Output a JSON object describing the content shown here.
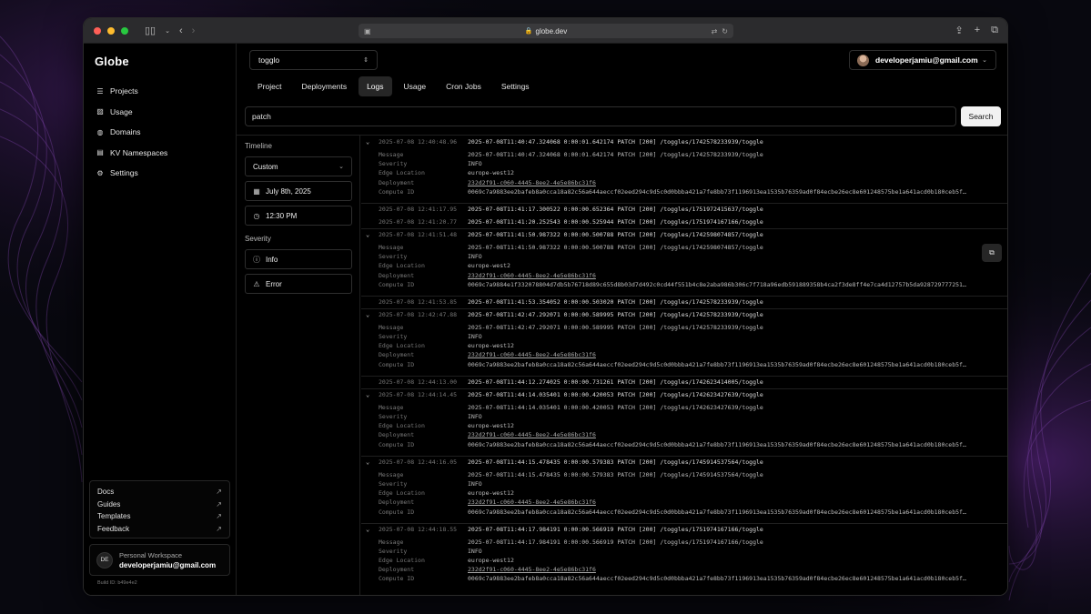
{
  "browser": {
    "url": "globe.dev"
  },
  "app": {
    "logo": "Globe",
    "build_id": "Build ID: b49e4e2"
  },
  "sidebar": {
    "items": [
      {
        "label": "Projects",
        "icon": "database-icon"
      },
      {
        "label": "Usage",
        "icon": "chart-icon"
      },
      {
        "label": "Domains",
        "icon": "globe-icon"
      },
      {
        "label": "KV Namespaces",
        "icon": "table-icon"
      },
      {
        "label": "Settings",
        "icon": "gear-icon"
      }
    ],
    "links": [
      {
        "label": "Docs"
      },
      {
        "label": "Guides"
      },
      {
        "label": "Templates"
      },
      {
        "label": "Feedback"
      }
    ],
    "workspace": {
      "initials": "DE",
      "label": "Personal Workspace",
      "email": "developerjamiu@gmail.com"
    }
  },
  "header": {
    "project": "togglo",
    "user_email": "developerjamiu@gmail.com",
    "tabs": [
      {
        "label": "Project"
      },
      {
        "label": "Deployments"
      },
      {
        "label": "Logs"
      },
      {
        "label": "Usage"
      },
      {
        "label": "Cron Jobs"
      },
      {
        "label": "Settings"
      }
    ],
    "active_tab": "Logs"
  },
  "search": {
    "value": "patch",
    "button": "Search"
  },
  "filters": {
    "timeline_label": "Timeline",
    "range": "Custom",
    "date": "July 8th, 2025",
    "time": "12:30 PM",
    "severity_label": "Severity",
    "severity_options": [
      "Info",
      "Error"
    ]
  },
  "detail_labels": {
    "message": "Message",
    "severity": "Severity",
    "edge": "Edge Location",
    "deployment": "Deployment",
    "compute": "Compute ID"
  },
  "logs": [
    {
      "ts": "2025-07-08 12:40:48.96",
      "msg": "2025-07-08T11:40:47.324068 0:00:01.642174 PATCH [200] /toggles/1742578233939/toggle",
      "expanded": true,
      "detail_msg": "2025-07-08T11:40:47.324068  0:00:01.642174  PATCH   [200] /toggles/1742578233939/toggle",
      "severity": "INFO",
      "edge": "europe-west12",
      "deployment": "232d2f91-c060-4445-8ee2-4e5e86bc31f6",
      "compute": "0069c7a9883ee2bafeb8a0cca18a82c56a644aeccf02eed294c9d5c0d0bbba421a7fe8bb73f1196913ea1535b76359ad0f84ecbe26ec8e601248575be1a641acd0b180ceb5f…"
    },
    {
      "ts": "2025-07-08 12:41:17.95",
      "msg": "2025-07-08T11:41:17.300522 0:00:00.652364 PATCH [200] /toggles/1751972415637/toggle",
      "expanded": false
    },
    {
      "ts": "2025-07-08 12:41:20.77",
      "msg": "2025-07-08T11:41:20.252543 0:00:00.525944 PATCH [200] /toggles/1751974167166/toggle",
      "expanded": false
    },
    {
      "ts": "2025-07-08 12:41:51.48",
      "msg": "2025-07-08T11:41:50.987322 0:00:00.500788 PATCH [200] /toggles/1742598074857/toggle",
      "expanded": true,
      "copy": true,
      "detail_msg": "2025-07-08T11:41:50.987322  0:00:00.500788  PATCH   [200] /toggles/1742598074857/toggle",
      "severity": "INFO",
      "edge": "europe-west2",
      "deployment": "232d2f91-c060-4445-8ee2-4e5e86bc31f6",
      "compute": "0069c7a9884e1f332078804d7db5b76718d89c655d8b03d7d492c0cd44f551b4c8e2aba986b306c7f718a96edb591889358b4ca2f3de8ff4e7ca4d12757b5da928729777251…"
    },
    {
      "ts": "2025-07-08 12:41:53.85",
      "msg": "2025-07-08T11:41:53.354052 0:00:00.503020 PATCH [200] /toggles/1742578233939/toggle",
      "expanded": false
    },
    {
      "ts": "2025-07-08 12:42:47.88",
      "msg": "2025-07-08T11:42:47.292071 0:00:00.589995 PATCH [200] /toggles/1742578233939/toggle",
      "expanded": true,
      "detail_msg": "2025-07-08T11:42:47.292071  0:00:00.589995  PATCH   [200] /toggles/1742578233939/toggle",
      "severity": "INFO",
      "edge": "europe-west12",
      "deployment": "232d2f91-c060-4445-8ee2-4e5e86bc31f6",
      "compute": "0069c7a9883ee2bafeb8a0cca18a82c56a644aeccf02eed294c9d5c0d0bbba421a7fe8bb73f1196913ea1535b76359ad0f84ecbe26ec8e601248575be1a641acd0b180ceb5f…"
    },
    {
      "ts": "2025-07-08 12:44:13.00",
      "msg": "2025-07-08T11:44:12.274025 0:00:00.731261 PATCH [200] /toggles/1742623414005/toggle",
      "expanded": false
    },
    {
      "ts": "2025-07-08 12:44:14.45",
      "msg": "2025-07-08T11:44:14.035401 0:00:00.420053 PATCH [200] /toggles/1742623427639/toggle",
      "expanded": true,
      "detail_msg": "2025-07-08T11:44:14.035401  0:00:00.420053  PATCH   [200] /toggles/1742623427639/toggle",
      "severity": "INFO",
      "edge": "europe-west12",
      "deployment": "232d2f91-c060-4445-8ee2-4e5e86bc31f6",
      "compute": "0069c7a9883ee2bafeb8a0cca18a82c56a644aeccf02eed294c9d5c0d0bbba421a7fe8bb73f1196913ea1535b76359ad0f84ecbe26ec8e601248575be1a641acd0b180ceb5f…"
    },
    {
      "ts": "2025-07-08 12:44:16.05",
      "msg": "2025-07-08T11:44:15.478435 0:00:00.579383 PATCH [200] /toggles/1745914537564/toggle",
      "expanded": true,
      "detail_msg": "2025-07-08T11:44:15.478435  0:00:00.579383  PATCH   [200] /toggles/1745914537564/toggle",
      "severity": "INFO",
      "edge": "europe-west12",
      "deployment": "232d2f91-c060-4445-8ee2-4e5e86bc31f6",
      "compute": "0069c7a9883ee2bafeb8a0cca18a82c56a644aeccf02eed294c9d5c0d0bbba421a7fe8bb73f1196913ea1535b76359ad0f84ecbe26ec8e601248575be1a641acd0b180ceb5f…"
    },
    {
      "ts": "2025-07-08 12:44:18.55",
      "msg": "2025-07-08T11:44:17.984191 0:00:00.566919 PATCH [200] /toggles/1751974167166/toggle",
      "expanded": true,
      "detail_msg": "2025-07-08T11:44:17.984191  0:00:00.566919  PATCH   [200] /toggles/1751974167166/toggle",
      "severity": "INFO",
      "edge": "europe-west12",
      "deployment": "232d2f91-c060-4445-8ee2-4e5e86bc31f6",
      "compute": "0069c7a9883ee2bafeb8a0cca18a82c56a644aeccf02eed294c9d5c0d0bbba421a7fe8bb73f1196913ea1535b76359ad0f84ecbe26ec8e601248575be1a641acd0b180ceb5f…"
    }
  ],
  "colors": {
    "window_bg": "#000000",
    "titlebar": "#2b2b2d",
    "close": "#ff5f57",
    "minimize": "#febc2e",
    "zoom": "#28c840",
    "accent_button": "#f2f2f2",
    "wallpaper_line": "#7a3ea8"
  }
}
